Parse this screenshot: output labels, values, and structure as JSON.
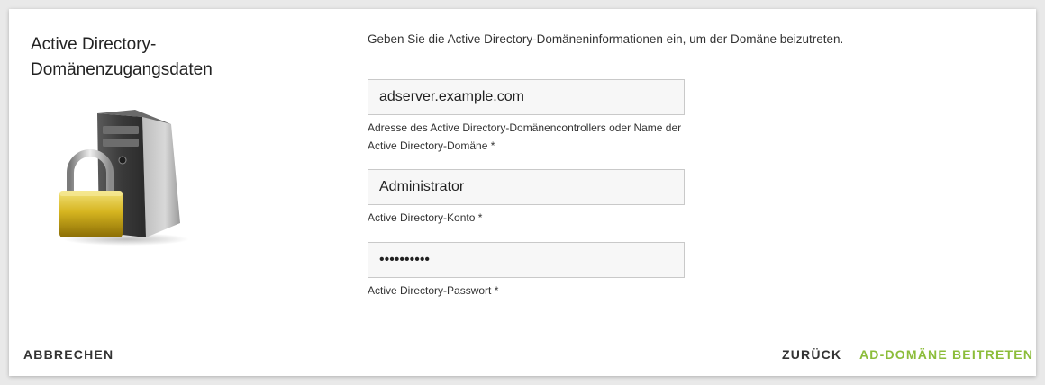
{
  "dialog": {
    "title": "Active Directory-Domänenzugangsdaten",
    "intro": "Geben Sie die Active Directory-Domäneninformationen ein, um der Domäne beizutreten."
  },
  "fields": {
    "server": {
      "value": "adserver.example.com",
      "help": "Adresse des Active Directory-Domänencontrollers oder Name der Active Directory-Domäne *"
    },
    "account": {
      "value": "Administrator",
      "help": "Active Directory-Konto *"
    },
    "password": {
      "value": "••••••••••",
      "help": "Active Directory-Passwort *"
    }
  },
  "buttons": {
    "cancel": "ABBRECHEN",
    "back": "ZURÜCK",
    "join": "AD-DOMÄNE BEITRETEN"
  },
  "colors": {
    "accent": "#8cbd3a"
  },
  "icons": {
    "illustration": "server-padlock-icon"
  }
}
